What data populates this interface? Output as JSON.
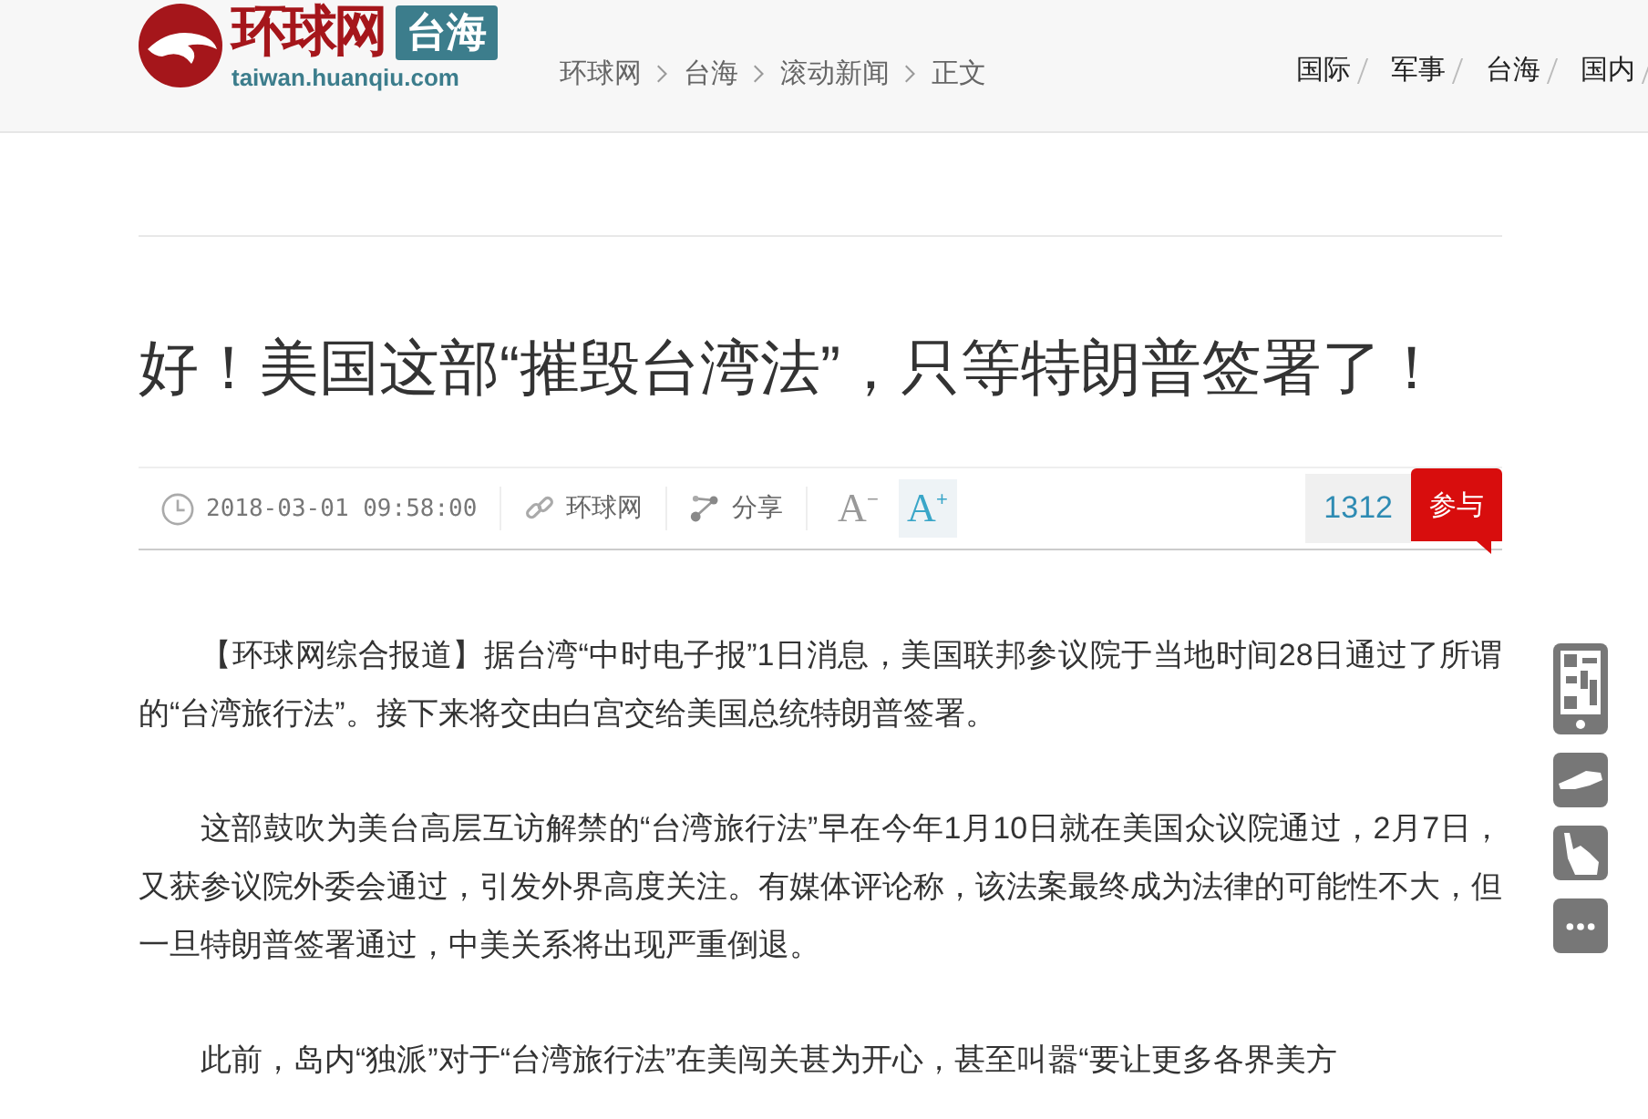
{
  "header": {
    "logo": {
      "name": "环球网",
      "channel": "台海",
      "domain": "taiwan.huanqiu.com"
    },
    "breadcrumb": [
      "环球网",
      "台海",
      "滚动新闻",
      "正文"
    ],
    "nav": [
      "国际",
      "军事",
      "台海",
      "国内"
    ]
  },
  "article": {
    "title": "好！美国这部“摧毁台湾法”，只等特朗普签署了！",
    "meta": {
      "date": "2018-03-01 09:58:00",
      "source": "环球网",
      "share": "分享",
      "font_buttons": [
        {
          "label": "A",
          "mark": "−",
          "selected": false
        },
        {
          "label": "A",
          "mark": "+",
          "selected": true
        }
      ],
      "comment_count": "1312",
      "join": "参与"
    },
    "paragraphs": [
      "【环球网综合报道】据台湾“中时电子报”1日消息，美国联邦参议院于当地时间28日通过了所谓的“台湾旅行法”。接下来将交由白宫交给美国总统特朗普签署。",
      "这部鼓吹为美台高层互访解禁的“台湾旅行法”早在今年1月10日就在美国众议院通过，2月7日，又获参议院外委会通过，引发外界高度关注。有媒体评论称，该法案最终成为法律的可能性不大，但一旦特朗普签署通过，中美关系将出现严重倒退。",
      "此前，岛内“独派”对于“台湾旅行法”在美闯关甚为开心，甚至叫嚣“要让更多各界美方"
    ]
  }
}
